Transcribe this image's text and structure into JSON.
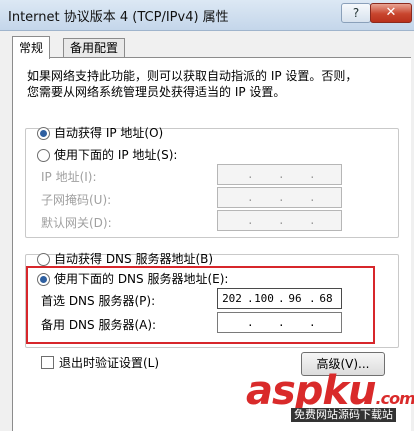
{
  "window": {
    "title": "Internet 协议版本 4 (TCP/IPv4) 属性",
    "help_label": "?",
    "close_label": "✕"
  },
  "tabs": [
    {
      "label": "常规",
      "active": true
    },
    {
      "label": "备用配置",
      "active": false
    }
  ],
  "description": {
    "line1": "如果网络支持此功能，则可以获取自动指派的 IP 设置。否则，",
    "line2": "您需要从网络系统管理员处获得适当的 IP 设置。"
  },
  "ip": {
    "auto_label": "自动获得 IP 地址(O)",
    "manual_label": "使用下面的 IP 地址(S):",
    "auto_selected": true,
    "fields": [
      {
        "label": "IP 地址(I):",
        "value": [
          ".",
          ".",
          "."
        ]
      },
      {
        "label": "子网掩码(U):",
        "value": [
          ".",
          ".",
          "."
        ]
      },
      {
        "label": "默认网关(D):",
        "value": [
          ".",
          ".",
          "."
        ]
      }
    ]
  },
  "dns": {
    "auto_label": "自动获得 DNS 服务器地址(B)",
    "manual_label": "使用下面的 DNS 服务器地址(E):",
    "manual_selected": true,
    "preferred_label": "首选 DNS 服务器(P):",
    "preferred_value": [
      "202",
      "100",
      "96",
      "68"
    ],
    "alternate_label": "备用 DNS 服务器(A):",
    "alternate_value": [
      "",
      "",
      "",
      ""
    ]
  },
  "footer": {
    "validate_label": "退出时验证设置(L)",
    "validate_checked": false,
    "advanced_label": "高级(V)..."
  },
  "watermark": {
    "logo": "aspku",
    "logo_suffix": ".com",
    "tagline": "免费网站源码下载站"
  },
  "colors": {
    "highlight_border": "#d7262b",
    "radio_fill": "#2e5fa0"
  }
}
